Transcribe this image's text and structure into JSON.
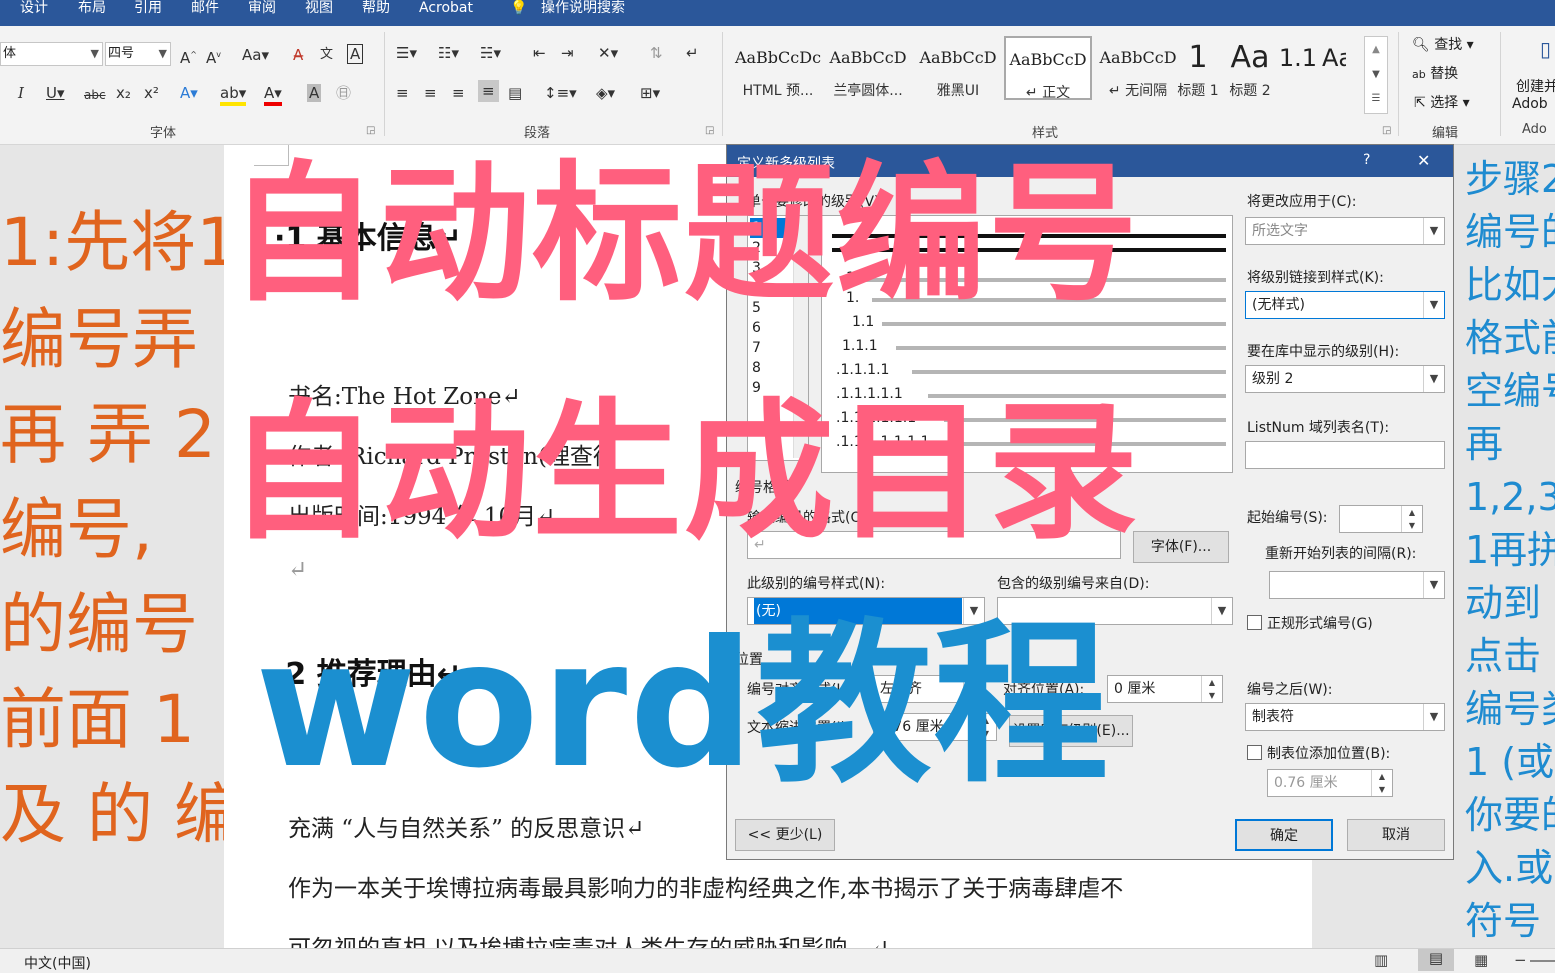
{
  "ribbon_tabs": [
    "设计",
    "布局",
    "引用",
    "邮件",
    "审阅",
    "视图",
    "帮助",
    "Acrobat",
    "操作说明搜索"
  ],
  "font_group": {
    "font_name": "体",
    "font_size": "四号",
    "label": "字体"
  },
  "paragraph_group": {
    "label": "段落"
  },
  "styles_group": {
    "label": "样式",
    "styles": [
      {
        "sample": "AaBbCcDc",
        "name": "HTML 预..."
      },
      {
        "sample": "AaBbCcD",
        "name": "兰亭圆体..."
      },
      {
        "sample": "AaBbCcD",
        "name": "雅黑UI"
      },
      {
        "sample": "AaBbCcD",
        "name": "↵ 正文"
      },
      {
        "sample": "AaBbCcD",
        "name": "↵ 无间隔"
      },
      {
        "sample": "1",
        "name": "标题 1"
      },
      {
        "sample": "Aa",
        "name": "标题 2"
      },
      {
        "sample": "1.1",
        "name": ""
      },
      {
        "sample": "Aa",
        "name": ""
      }
    ]
  },
  "editing_group": {
    "find": "查找",
    "replace": "替换",
    "select": "选择",
    "label": "编辑"
  },
  "adobe_group": {
    "create": "创建并",
    "adobe": "Adob",
    "label": "Ado"
  },
  "left_overlay": [
    "1:先将1",
    "编号弄",
    "再 弄 2",
    "编号,",
    "的编号",
    "前面 1",
    "及 的 编"
  ],
  "right_overlay": [
    "步骤2",
    "编号的",
    "比如大",
    "格式前",
    "空编号",
    "再",
    "1,2,3",
    "1再拼",
    "动到",
    "点击",
    "编号类",
    "1 (或",
    "你要的",
    "入.或",
    "符号"
  ],
  "document": {
    "heading1": "·1 基本信息↵",
    "book_name": "书名:The Hot Zone↵",
    "author": "作者: Richard Preston(理查德",
    "publish": "出版时间:1994 年 10月↵",
    "blank": "↵",
    "heading2": "·2 推荐理由↵",
    "para1": "充满 “人与自然关系” 的反思意识↵",
    "para2": "作为一本关于埃博拉病毒最具影响力的非虚构经典之作,本书揭示了关于病毒肆虐不",
    "para3": "可忽视的真相,以及埃博拉病毒对人类生存的威胁和影响。↵"
  },
  "dialog": {
    "title": "定义新多级列表",
    "help": "?",
    "close": "✕",
    "levels_label": "单击要修改的级别(V):",
    "levels": [
      "1",
      "2",
      "3",
      "4",
      "5",
      "6",
      "7",
      "8",
      "9"
    ],
    "preview_numbers": [
      "1",
      "1.",
      "1.1",
      "1.1.1",
      ".1.1.1.1",
      ".1.1.1.1.1",
      ".1.1.1.1.1.1",
      ".1.1.1.1.1.1.1"
    ],
    "apply_to_label": "将更改应用于(C):",
    "apply_to_value": "所选文字",
    "link_style_label": "将级别链接到样式(K):",
    "link_style_value": "(无样式)",
    "gallery_level_label": "要在库中显示的级别(H):",
    "gallery_level_value": "级别 2",
    "listnum_label": "ListNum 域列表名(T):",
    "number_format_section": "编号格式",
    "enter_format_label": "输入编号的格式(O):",
    "enter_format_value": "↵",
    "font_button": "字体(F)...",
    "start_at_label": "起始编号(S):",
    "restart_label": "重新开始列表的间隔(R):",
    "number_style_label": "此级别的编号样式(N):",
    "number_style_value": "(无)",
    "include_level_label": "包含的级别编号来自(D):",
    "legal_label": "正规形式编号(G)",
    "position_section": "位置",
    "alignment_label": "编号对齐方式(U):",
    "alignment_value": "左对齐",
    "align_at_label": "对齐位置(A):",
    "align_at_value": "0 厘米",
    "indent_label": "文本缩进位置(I):",
    "indent_value": "0.76 厘米",
    "set_all_button": "设置所有级别(E)...",
    "follow_label": "编号之后(W):",
    "follow_value": "制表符",
    "tab_stop_label": "制表位添加位置(B):",
    "tab_stop_value": "0.76 厘米",
    "less_button": "<< 更少(L)",
    "ok_button": "确定",
    "cancel_button": "取消"
  },
  "overlay_titles": {
    "line1": "自动标题编号",
    "line2": "自动生成目录",
    "line3": "word教程"
  },
  "status_bar": {
    "language": "中文(中国)"
  }
}
